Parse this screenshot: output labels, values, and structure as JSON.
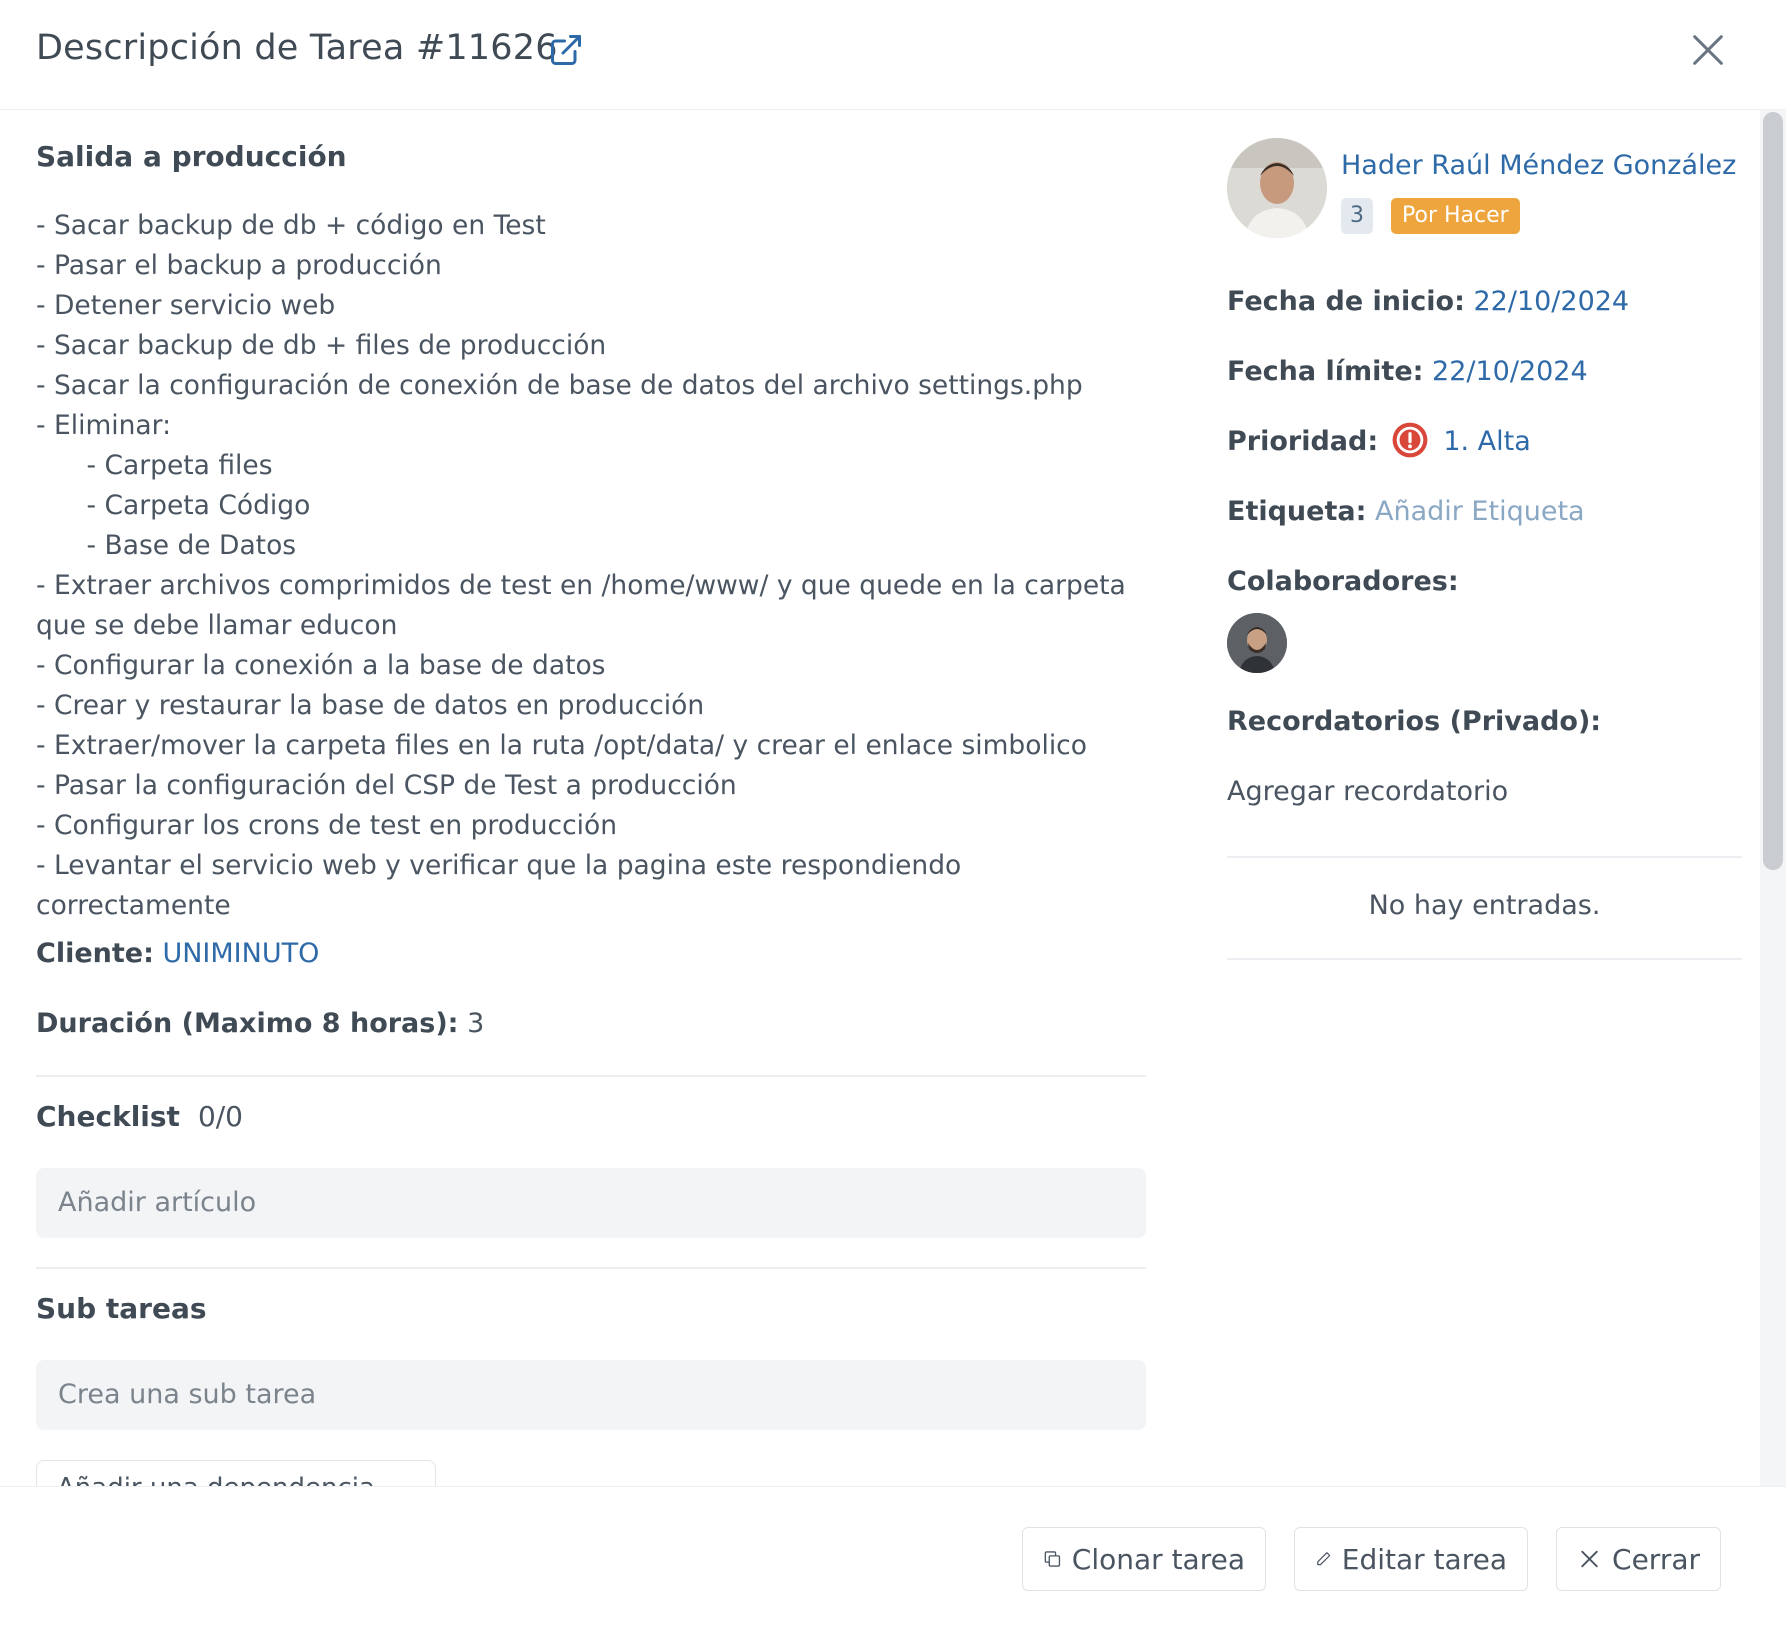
{
  "header": {
    "title": "Descripción de Tarea #11626",
    "icons": {
      "external": "external-link-icon",
      "close": "close-icon"
    }
  },
  "description": {
    "title": "Salida a producción",
    "body": "- Sacar backup de db + código en Test\n- Pasar el backup a producción\n- Detener servicio web\n- Sacar backup de db + files de producción\n- Sacar la configuración de conexión de base de datos del archivo settings.php\n- Eliminar:\n      - Carpeta files\n      - Carpeta Código\n      - Base de Datos\n- Extraer archivos comprimidos de test en /home/www/ y que quede en la carpeta que se debe llamar educon\n- Configurar la conexión a la base de datos\n- Crear y restaurar la base de datos en producción\n- Extraer/mover la carpeta files en la ruta /opt/data/ y crear el enlace simbolico\n- Pasar la configuración del CSP de Test a producción\n- Configurar los crons de test en producción\n- Levantar el servicio web y verificar que la pagina este respondiendo correctamente"
  },
  "fields": {
    "client_label": "Cliente:",
    "client_value": "UNIMINUTO",
    "duration_label": "Duración (Maximo 8 horas):",
    "duration_value": "3"
  },
  "checklist": {
    "title": "Checklist",
    "count": "0/0",
    "placeholder": "Añadir artículo"
  },
  "subtasks": {
    "title": "Sub tareas",
    "placeholder": "Crea una sub tarea",
    "dependency_button": "Añadir una dependencia"
  },
  "sidebar": {
    "assignee_name": "Hader Raúl Méndez González",
    "badge_number": "3",
    "status": "Por Hacer",
    "start_label": "Fecha de inicio:",
    "start_value": "22/10/2024",
    "due_label": "Fecha límite:",
    "due_value": "22/10/2024",
    "priority_label": "Prioridad:",
    "priority_value": "1. Alta",
    "tag_label": "Etiqueta:",
    "tag_value": "Añadir Etiqueta",
    "collaborators_label": "Colaboradores:",
    "reminders_label": "Recordatorios (Privado):",
    "add_reminder": "Agregar recordatorio",
    "no_entries": "No hay entradas."
  },
  "footer": {
    "clone_label": "Clonar tarea",
    "edit_label": "Editar tarea",
    "close_label": "Cerrar"
  },
  "colors": {
    "link": "#2e6aa8",
    "status_badge": "#efa53e",
    "priority_high": "#d9473a"
  }
}
